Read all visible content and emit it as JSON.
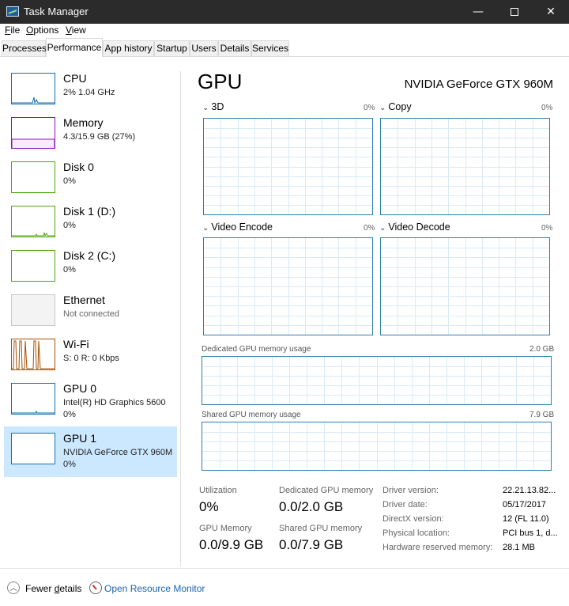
{
  "window": {
    "title": "Task Manager",
    "minimize_glyph": "—",
    "close_glyph": "✕"
  },
  "menu": [
    {
      "label": "File",
      "accel": "F",
      "rest": "ile"
    },
    {
      "label": "Options",
      "accel": "O",
      "rest": "ptions"
    },
    {
      "label": "View",
      "accel": "V",
      "rest": "iew"
    }
  ],
  "tabs": [
    "Processes",
    "Performance",
    "App history",
    "Startup",
    "Users",
    "Details",
    "Services"
  ],
  "active_tab": "Performance",
  "sidebar": {
    "items": [
      {
        "name": "CPU",
        "sub1": "2% 1.04 GHz",
        "sub2": ""
      },
      {
        "name": "Memory",
        "sub1": "4.3/15.9 GB (27%)",
        "sub2": ""
      },
      {
        "name": "Disk 0",
        "sub1": "0%",
        "sub2": ""
      },
      {
        "name": "Disk 1 (D:)",
        "sub1": "0%",
        "sub2": ""
      },
      {
        "name": "Disk 2 (C:)",
        "sub1": "0%",
        "sub2": ""
      },
      {
        "name": "Ethernet",
        "sub1": "Not connected",
        "sub2": ""
      },
      {
        "name": "Wi-Fi",
        "sub1": "S: 0 R: 0 Kbps",
        "sub2": ""
      },
      {
        "name": "GPU 0",
        "sub1": "Intel(R) HD Graphics 5600",
        "sub2": "0%"
      },
      {
        "name": "GPU 1",
        "sub1": "NVIDIA GeForce GTX 960M",
        "sub2": "0%"
      }
    ],
    "selected": "GPU 1",
    "colors": {
      "cpu": "#1170b3",
      "memory": "#8b12ae",
      "disk": "#4da60c",
      "ethernet": "#c8c8c8",
      "wifi": "#a74f01",
      "gpu": "#1170b3"
    }
  },
  "main": {
    "heading": "GPU",
    "model": "NVIDIA GeForce GTX 960M",
    "engines": [
      {
        "label": "3D",
        "percent": "0%"
      },
      {
        "label": "Copy",
        "percent": "0%"
      },
      {
        "label": "Video Encode",
        "percent": "0%"
      },
      {
        "label": "Video Decode",
        "percent": "0%"
      }
    ],
    "dedicated_memory": {
      "label": "Dedicated GPU memory usage",
      "max": "2.0 GB"
    },
    "shared_memory": {
      "label": "Shared GPU memory usage",
      "max": "7.9 GB"
    },
    "graph_color": "#2f7fae",
    "grid_color": "#d9eaf5"
  },
  "stats": {
    "utilization": {
      "label": "Utilization",
      "value": "0%"
    },
    "dedicated": {
      "label": "Dedicated GPU memory",
      "value": "0.0/2.0 GB"
    },
    "gpu_memory": {
      "label": "GPU Memory",
      "value": "0.0/9.9 GB"
    },
    "shared": {
      "label": "Shared GPU memory",
      "value": "0.0/7.9 GB"
    }
  },
  "properties": [
    {
      "label": "Driver version:",
      "value": "22.21.13.82..."
    },
    {
      "label": "Driver date:",
      "value": "05/17/2017"
    },
    {
      "label": "DirectX version:",
      "value": "12 (FL 11.0)"
    },
    {
      "label": "Physical location:",
      "value": "PCI bus 1, d..."
    },
    {
      "label": "Hardware reserved memory:",
      "value": "28.1 MB"
    }
  ],
  "footer": {
    "fewer_details_accel": "d",
    "fewer_details_pre": "Fewer ",
    "fewer_details_post": "etails",
    "fewer_icon": "︿",
    "open_resource_monitor": "Open Resource Monitor"
  }
}
